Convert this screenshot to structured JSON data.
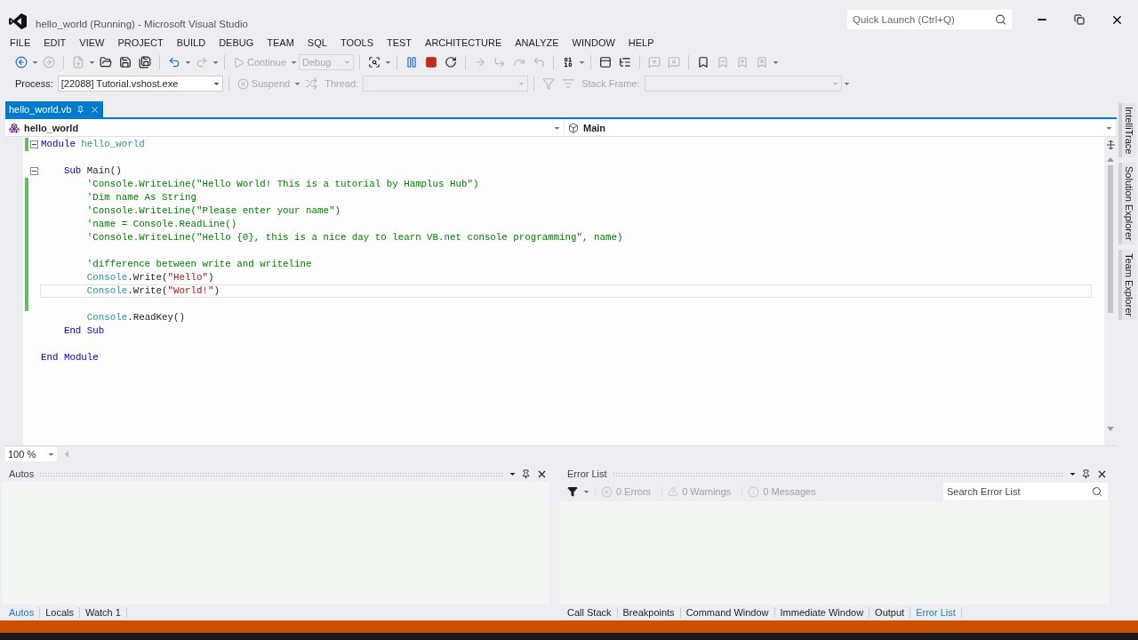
{
  "window": {
    "title": "hello_world (Running) - Microsoft Visual Studio"
  },
  "quick_launch": {
    "placeholder": "Quick Launch (Ctrl+Q)"
  },
  "menu": [
    "FILE",
    "EDIT",
    "VIEW",
    "PROJECT",
    "BUILD",
    "DEBUG",
    "TEAM",
    "SQL",
    "TOOLS",
    "TEST",
    "ARCHITECTURE",
    "ANALYZE",
    "WINDOW",
    "HELP"
  ],
  "toolbar": [
    [
      {
        "kind": "icon",
        "disabled": false
      },
      {
        "kind": "caret"
      },
      {
        "kind": "icon",
        "disabled": true
      }
    ],
    [
      {
        "kind": "icon",
        "disabled": true
      },
      {
        "kind": "caret"
      },
      {
        "kind": "icon",
        "disabled": false
      },
      {
        "kind": "icon",
        "disabled": false
      },
      {
        "kind": "icon",
        "disabled": false
      }
    ],
    [
      {
        "kind": "icon",
        "disabled": false
      },
      {
        "kind": "caret"
      },
      {
        "kind": "icon",
        "disabled": true
      },
      {
        "kind": "caret"
      }
    ],
    [
      {
        "kind": "button",
        "label": "Continue",
        "disabled": true
      },
      {
        "kind": "caret"
      },
      {
        "kind": "combo",
        "value": "Debug",
        "disabled": true
      }
    ],
    [
      {
        "kind": "icon",
        "disabled": false
      },
      {
        "kind": "caret"
      }
    ],
    [
      {
        "kind": "icon",
        "disabled": false
      },
      {
        "kind": "icon",
        "disabled": false
      },
      {
        "kind": "icon",
        "disabled": false
      }
    ],
    [
      {
        "kind": "icon",
        "disabled": true
      },
      {
        "kind": "icon",
        "disabled": true
      },
      {
        "kind": "icon",
        "disabled": true
      },
      {
        "kind": "icon",
        "disabled": true
      }
    ],
    [
      {
        "kind": "icon",
        "disabled": false
      },
      {
        "kind": "caret"
      }
    ],
    [
      {
        "kind": "icon",
        "disabled": false
      },
      {
        "kind": "icon",
        "disabled": false
      }
    ],
    [
      {
        "kind": "icon",
        "disabled": true
      },
      {
        "kind": "icon",
        "disabled": true
      }
    ],
    [
      {
        "kind": "icon",
        "disabled": false
      },
      {
        "kind": "icon",
        "disabled": true
      },
      {
        "kind": "icon",
        "disabled": true
      },
      {
        "kind": "icon",
        "disabled": true
      },
      {
        "kind": "caret"
      }
    ]
  ],
  "debug_location": [
    [
      {
        "kind": "label",
        "text": "Process:",
        "disabled": false
      },
      {
        "kind": "combo",
        "value": "[22088] Tutorial.vshost.exe",
        "disabled": false
      }
    ],
    [
      {
        "kind": "button",
        "label": "Suspend",
        "disabled": true
      },
      {
        "kind": "caret"
      },
      {
        "kind": "icon",
        "disabled": true
      },
      {
        "kind": "label",
        "text": "Thread:",
        "disabled": true
      },
      {
        "kind": "combo",
        "disabled": true
      }
    ],
    [
      {
        "kind": "icon",
        "disabled": true
      },
      {
        "kind": "icon",
        "disabled": true
      },
      {
        "kind": "label",
        "text": "Stack Frame:",
        "disabled": true
      },
      {
        "kind": "combo",
        "disabled": true
      },
      {
        "kind": "caret"
      }
    ]
  ],
  "document_tabs": [
    {
      "label": "hello_world.vb",
      "selected": true
    }
  ],
  "navigation": {
    "type": "hello_world",
    "member": "Main"
  },
  "code": [
    {
      "kind": "code",
      "fold": true,
      "changed": true,
      "current": false,
      "tokens": [
        {
          "text": "Module",
          "kind": "keyword"
        },
        {
          "text": " hello_world",
          "kind": "type"
        }
      ],
      "children": [
        {
          "kind": "blank",
          "fold": false,
          "changed": false,
          "current": false
        },
        {
          "kind": "code",
          "fold": true,
          "changed": false,
          "current": false,
          "tokens": [
            {
              "text": "Sub",
              "kind": "keyword"
            },
            {
              "text": " Main()",
              "kind": "plain"
            }
          ],
          "children": [
            {
              "kind": "code",
              "fold": false,
              "changed": true,
              "current": false,
              "tokens": [
                {
                  "text": "'Console.WriteLine(\"Hello World! This is a tutorial by Hamplus Hub\")",
                  "kind": "comment"
                }
              ]
            },
            {
              "kind": "code",
              "fold": false,
              "changed": true,
              "current": false,
              "tokens": [
                {
                  "text": "'Dim name As String",
                  "kind": "comment"
                }
              ]
            },
            {
              "kind": "code",
              "fold": false,
              "changed": true,
              "current": false,
              "tokens": [
                {
                  "text": "'Console.WriteLine(\"Please enter your name\")",
                  "kind": "comment"
                }
              ]
            },
            {
              "kind": "code",
              "fold": false,
              "changed": true,
              "current": false,
              "tokens": [
                {
                  "text": "'name = Console.ReadLine()",
                  "kind": "comment"
                }
              ]
            },
            {
              "kind": "code",
              "fold": false,
              "changed": true,
              "current": false,
              "tokens": [
                {
                  "text": "'Console.WriteLine(\"Hello {0}, this is a nice day to learn VB.net console programming\", name)",
                  "kind": "comment"
                }
              ]
            },
            {
              "kind": "blank",
              "fold": false,
              "changed": true,
              "current": false
            },
            {
              "kind": "code",
              "fold": false,
              "changed": true,
              "current": false,
              "tokens": [
                {
                  "text": "'difference between write and writeline",
                  "kind": "comment"
                }
              ]
            },
            {
              "kind": "code",
              "fold": false,
              "changed": true,
              "current": false,
              "tokens": [
                {
                  "text": "Console",
                  "kind": "type"
                },
                {
                  "text": ".Write(",
                  "kind": "plain"
                },
                {
                  "text": "\"Hello\"",
                  "kind": "string"
                },
                {
                  "text": ")",
                  "kind": "plain"
                }
              ]
            },
            {
              "kind": "code",
              "fold": false,
              "changed": true,
              "current": true,
              "tokens": [
                {
                  "text": "Console",
                  "kind": "type"
                },
                {
                  "text": ".Write(",
                  "kind": "plain"
                },
                {
                  "text": "\"World!\"",
                  "kind": "string"
                },
                {
                  "text": ")",
                  "kind": "plain"
                }
              ]
            },
            {
              "kind": "blank",
              "fold": false,
              "changed": true,
              "current": false
            },
            {
              "kind": "code",
              "fold": false,
              "changed": false,
              "current": false,
              "tokens": [
                {
                  "text": "Console",
                  "kind": "type"
                },
                {
                  "text": ".ReadKey()",
                  "kind": "plain"
                }
              ]
            }
          ]
        },
        {
          "kind": "code",
          "fold": false,
          "changed": false,
          "current": false,
          "tokens": [
            {
              "text": "End Sub",
              "kind": "keyword"
            }
          ]
        },
        {
          "kind": "blank",
          "fold": false,
          "changed": false,
          "current": false
        }
      ]
    },
    {
      "kind": "code",
      "fold": false,
      "changed": false,
      "current": false,
      "tokens": [
        {
          "text": "End Module",
          "kind": "keyword"
        }
      ]
    }
  ],
  "zoom": "100 %",
  "side_tabs": [
    "IntelliTrace",
    "Solution Explorer",
    "Team Explorer"
  ],
  "autos_panel": {
    "title": "Autos"
  },
  "error_list": {
    "title": "Error List",
    "errors": "0 Errors",
    "warnings": "0 Warnings",
    "messages": "0 Messages",
    "search": {
      "placeholder": "Search Error List"
    }
  },
  "left_tabs": [
    {
      "label": "Autos",
      "selected": true
    },
    {
      "label": "Locals",
      "selected": false
    },
    {
      "label": "Watch 1",
      "selected": false
    }
  ],
  "right_tabs": [
    {
      "label": "Call Stack",
      "selected": false
    },
    {
      "label": "Breakpoints",
      "selected": false
    },
    {
      "label": "Command Window",
      "selected": false
    },
    {
      "label": "Immediate Window",
      "selected": false
    },
    {
      "label": "Output",
      "selected": false
    },
    {
      "label": "Error List",
      "selected": true
    }
  ]
}
